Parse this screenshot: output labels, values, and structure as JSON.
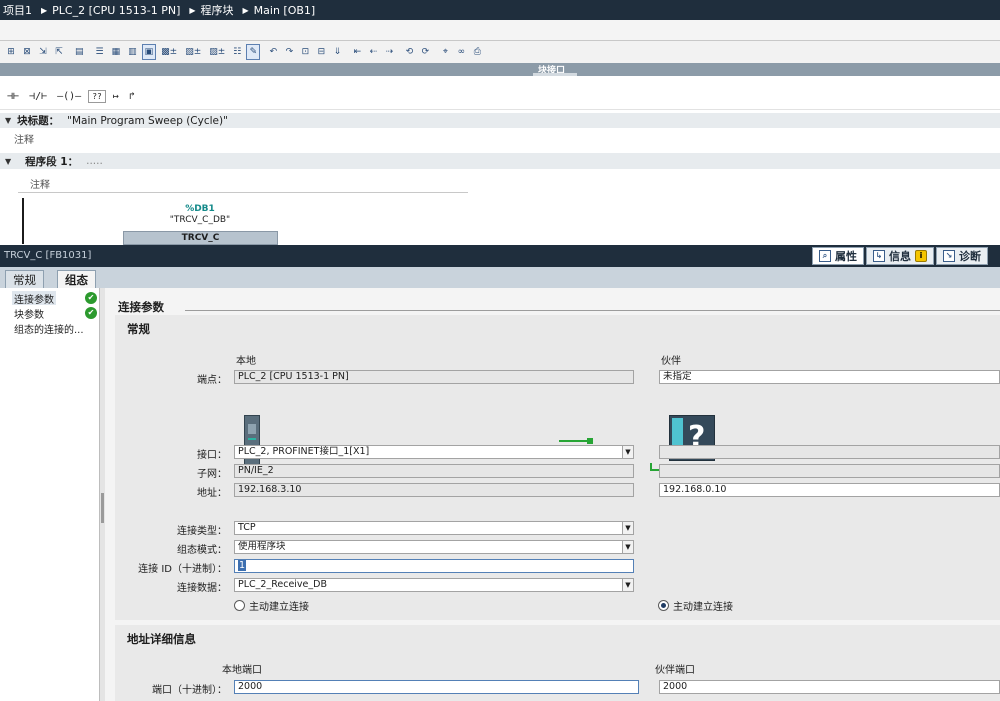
{
  "breadcrumb": [
    "项目1",
    "PLC_2 [CPU 1513-1 PN]",
    "程序块",
    "Main [OB1]"
  ],
  "interface_bar": {
    "label": "块接口"
  },
  "ladder_toolbar": {
    "items": [
      "⊣⊢",
      "⊣/⊢",
      "–()–",
      "??",
      "↦",
      "↱"
    ]
  },
  "block": {
    "title_label": "块标题：",
    "title_value": "\"Main Program Sweep (Cycle)\"",
    "comment": "注释"
  },
  "network": {
    "label": "程序段 1：",
    "dots": ".....",
    "comment": "注释",
    "db_address": "%DB1",
    "db_name": "\"TRCV_C_DB\"",
    "fb_name": "TRCV_C"
  },
  "inspector": {
    "title": "TRCV_C [FB1031]",
    "tabs": [
      {
        "label": "属性",
        "icon": "properties-icon"
      },
      {
        "label": "信息",
        "icon": "info-icon"
      },
      {
        "label": "诊断",
        "icon": "diagnostics-icon"
      }
    ],
    "subtabs": [
      "常规",
      "组态"
    ],
    "nav": [
      {
        "label": "连接参数",
        "status": "ok"
      },
      {
        "label": "块参数",
        "status": "ok"
      },
      {
        "label": "组态的连接的..."
      }
    ]
  },
  "conn_params": {
    "section_title": "连接参数",
    "general_title": "常规",
    "local_header": "本地",
    "partner_header": "伙伴",
    "labels": {
      "endpoint": "端点：",
      "interface": "接口：",
      "subnet": "子网：",
      "address": "地址：",
      "conn_type": "连接类型：",
      "config_mode": "组态模式：",
      "conn_id": "连接 ID（十进制）：",
      "conn_data": "连接数据："
    },
    "local": {
      "endpoint": "PLC_2 [CPU 1513-1 PN]",
      "interface": "PLC_2, PROFINET接口_1[X1]",
      "subnet": "PN/IE_2",
      "address": "192.168.3.10"
    },
    "partner": {
      "endpoint": "未指定",
      "interface": "",
      "subnet": "",
      "address": "192.168.0.10"
    },
    "conn_type": "TCP",
    "config_mode": "使用程序块",
    "conn_id": "1",
    "conn_data": "PLC_2_Receive_DB",
    "local_active_label": "主动建立连接",
    "local_active": false,
    "partner_active_label": "主动建立连接",
    "partner_active": true
  },
  "address_details": {
    "title": "地址详细信息",
    "local_port_header": "本地端口",
    "partner_port_header": "伙伴端口",
    "port_label": "端口（十进制）：",
    "local_port": "2000",
    "partner_port": "2000"
  }
}
